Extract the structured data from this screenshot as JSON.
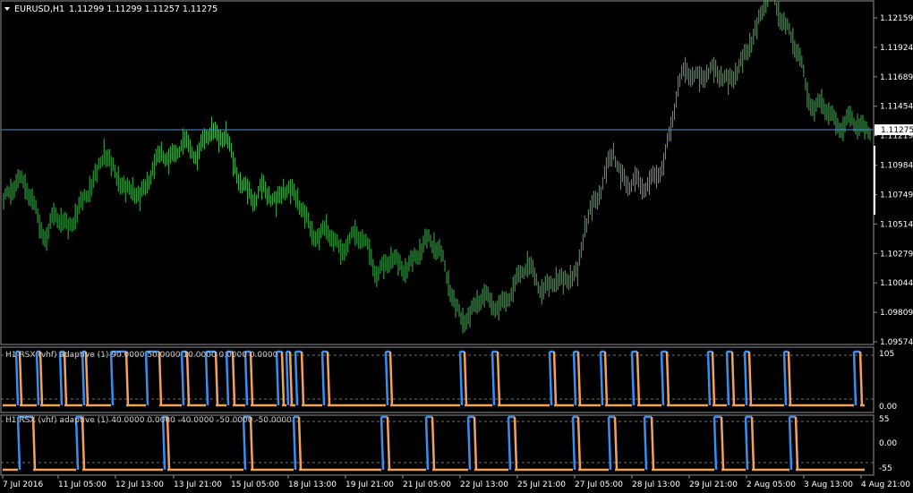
{
  "header": {
    "symbol": "EURUSD,H1",
    "ohlc": "1.11299 1.11299 1.11257 1.11275",
    "current_price": "1.11275",
    "arrow_icon": "dropdown-triangle-icon"
  },
  "price_axis": [
    "1.12159",
    "1.11924",
    "1.11689",
    "1.11454",
    "1.11219",
    "1.10984",
    "1.10749",
    "1.10514",
    "1.10279",
    "1.10044",
    "1.09809",
    "1.09574"
  ],
  "indicator1": {
    "title": "H1 RSX (vhf) adaptive (1) 90.0000 50.0000 10.0000 0.0000 0.0000",
    "axis_top": "105",
    "axis_bottom": "0.00"
  },
  "indicator2": {
    "title": "H1 RSX (vhf) adaptive (1) 40.0000 0.0000 -40.0000 -50.0000 -50.0000",
    "axis_top": "55",
    "axis_mid": "0.00",
    "axis_bottom": "-55"
  },
  "time_axis": [
    "7 Jul 2016",
    "11 Jul 05:00",
    "12 Jul 13:00",
    "13 Jul 21:00",
    "15 Jul 05:00",
    "18 Jul 13:00",
    "19 Jul 21:00",
    "21 Jul 05:00",
    "22 Jul 13:00",
    "25 Jul 21:00",
    "27 Jul 05:00",
    "28 Jul 13:00",
    "29 Jul 21:00",
    "2 Aug 05:00",
    "3 Aug 13:00",
    "4 Aug 21:00"
  ],
  "colors": {
    "background": "#000000",
    "candles": "#3cb44b",
    "price_line": "#4a90d9",
    "up_state": "#3a8ef0",
    "down_state": "#f2a25c",
    "grid": "#808080"
  },
  "chart_data": {
    "type": "line",
    "series": [
      {
        "values": [
          1.107,
          1.1078,
          1.1088,
          1.1082,
          1.1072,
          1.105,
          1.104,
          1.106,
          1.1055,
          1.1048,
          1.1058,
          1.107,
          1.108,
          1.1092,
          1.111,
          1.1098,
          1.1088,
          1.1078,
          1.108,
          1.1072,
          1.1085,
          1.1098,
          1.111,
          1.1102,
          1.1108,
          1.1118,
          1.1112,
          1.1105,
          1.112,
          1.1128,
          1.1118,
          1.1125,
          1.11,
          1.1085,
          1.1078,
          1.107,
          1.1082,
          1.1075,
          1.1068,
          1.108,
          1.1078,
          1.1072,
          1.1058,
          1.1045,
          1.104,
          1.105,
          1.1038,
          1.103,
          1.1036,
          1.1045,
          1.104,
          1.103,
          1.101,
          1.1018,
          1.1025,
          1.102,
          1.1015,
          1.1022,
          1.103,
          1.104,
          1.1035,
          1.1028,
          1.1005,
          1.0985,
          1.0975,
          1.0978,
          1.099,
          1.0995,
          1.0988,
          1.0985,
          1.099,
          1.1,
          1.1012,
          1.102,
          1.101,
          1.0998,
          1.1002,
          1.1008,
          1.1005,
          1.101,
          1.1012,
          1.105,
          1.1065,
          1.1075,
          1.1095,
          1.111,
          1.109,
          1.1082,
          1.1088,
          1.108,
          1.1085,
          1.109,
          1.11,
          1.1128,
          1.1162,
          1.1175,
          1.117,
          1.1168,
          1.1172,
          1.1175,
          1.117,
          1.1165,
          1.1172,
          1.1182,
          1.1195,
          1.1208,
          1.1228,
          1.1238,
          1.122,
          1.121,
          1.1198,
          1.1185,
          1.1155,
          1.1142,
          1.115,
          1.114,
          1.1132,
          1.1128,
          1.1138,
          1.113,
          1.1127
        ]
      }
    ]
  }
}
